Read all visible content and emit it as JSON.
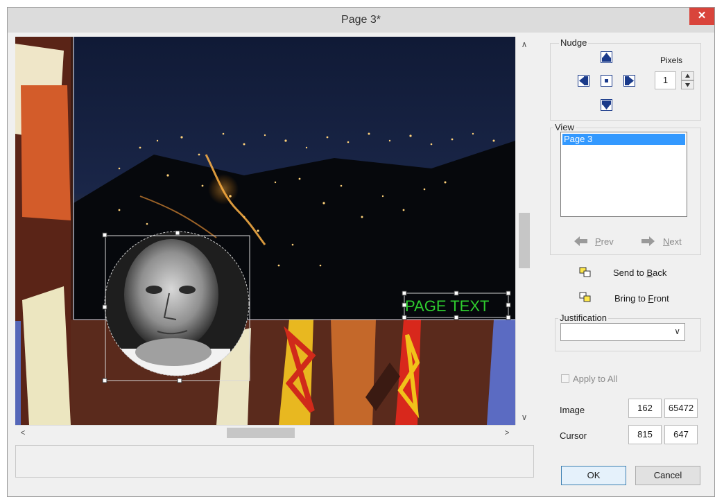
{
  "window": {
    "title": "Page 3*",
    "close_glyph": "✕"
  },
  "canvas": {
    "text_object": "PAGE TEXT",
    "text_color": "#2ecc2e"
  },
  "nudge": {
    "label": "Nudge",
    "pixels_label": "Pixels",
    "pixels_value": "1"
  },
  "view": {
    "label": "View",
    "items": [
      "Page 3"
    ],
    "selected": "Page 3"
  },
  "nav": {
    "prev_pre": "",
    "prev_ul": "P",
    "prev_post": "rev",
    "next_pre": "",
    "next_ul": "N",
    "next_post": "ext"
  },
  "actions": {
    "send_back_pre": "Send to ",
    "send_back_ul": "B",
    "send_back_post": "ack",
    "bring_front_pre": "Bring to ",
    "bring_front_ul": "F",
    "bring_front_post": "ront"
  },
  "justification": {
    "label": "Justification",
    "value": ""
  },
  "apply_all": {
    "label": "Apply to All",
    "checked": false
  },
  "image_info": {
    "label": "Image",
    "value1": "162",
    "value2": "65472"
  },
  "cursor_info": {
    "label": "Cursor",
    "value1": "815",
    "value2": "647"
  },
  "buttons": {
    "ok": "OK",
    "cancel": "Cancel"
  },
  "icons": [
    "nudge-up-icon",
    "nudge-left-icon",
    "nudge-center-icon",
    "nudge-right-icon",
    "nudge-down-icon",
    "prev-arrow-icon",
    "next-arrow-icon",
    "send-to-back-icon",
    "bring-to-front-icon",
    "chevron-down-icon"
  ]
}
